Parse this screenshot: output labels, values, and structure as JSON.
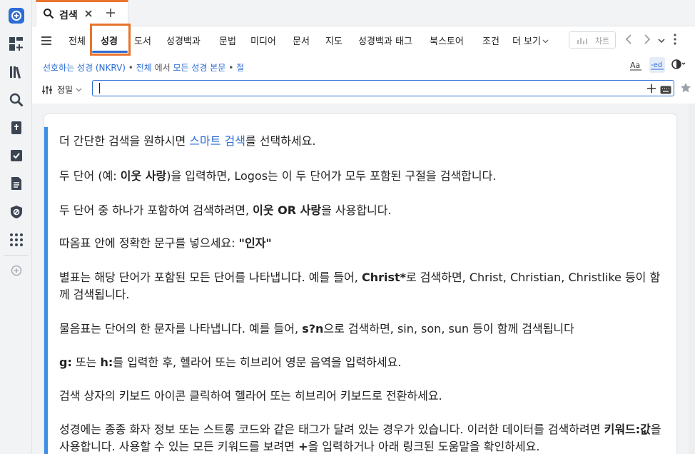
{
  "tab": {
    "label": "검색"
  },
  "categories": [
    "전체",
    "성경",
    "도서",
    "성경백과",
    "문법",
    "미디어",
    "문서",
    "지도",
    "성경백과 태그",
    "북스토어",
    "조건",
    "더 보기"
  ],
  "selected_category": "성경",
  "chart_button": {
    "label": "차트"
  },
  "scope": {
    "preferred_bible": "선호하는 성경 (NKRV)",
    "sep1": " • ",
    "all": "전체",
    "in_text": " 에서 ",
    "all_bible_text": "모든 성경 본문",
    "sep2": " • ",
    "verse": "절"
  },
  "options": {
    "precision": "정밀"
  },
  "search": {
    "value": "",
    "placeholder": ""
  },
  "help": [
    {
      "a": "더 간단한 검색을 원하시면 ",
      "link": "스마트 검색",
      "b": "를 선택하세요."
    },
    {
      "a": "두 단어 (예: ",
      "bold": "이웃 사랑",
      "b": ")을 입력하면, Logos는 이 두 단어가 모두 포함된 구절을 검색합니다."
    },
    {
      "a": "두 단어 중 하나가 포함하여 검색하려면, ",
      "bold": "이웃 OR 사랑",
      "b": "을 사용합니다."
    },
    {
      "a": "따옴표 안에 정확한 문구를 넣으세요: ",
      "bold": "\"인자\"",
      "b": ""
    },
    {
      "a": "별표는 해당 단어가 포함된 모든 단어를 나타냅니다. 예를 들어, ",
      "bold": "Christ*",
      "b": "로 검색하면, Christ, Christian, Christlike 등이 함께 검색됩니다."
    },
    {
      "a": "물음표는 단어의 한 문자를 나타냅니다. 예를 들어,  ",
      "bold": "s?n",
      "b": "으로 검색하면, sin, son, sun 등이 함께 검색됩니다"
    },
    {
      "bold1": "g:",
      "a": " 또는 ",
      "bold2": "h:",
      "b": "를 입력한 후, 헬라어 또는 히브리어 영문 음역을 입력하세요."
    },
    {
      "a": "검색 상자의 키보드 아이콘 클릭하여 헬라어 또는 히브리어 키보드로 전환하세요."
    },
    {
      "a": "성경에는 종종 화자 정보 또는 스트롱 코드와 같은 태그가 달려 있는 경우가 있습니다.  이러한 데이터를 검색하려면 ",
      "bold": "키워드:값",
      "b": "을 사용합니다. 사용할 수 있는 모든 키워드를 보려면 ",
      "bold2": "+",
      "c": "을 입력하거나 아래 링크된 도움말을 확인하세요."
    }
  ],
  "colors": {
    "accent_blue": "#2d6dd6",
    "highlight_orange": "#e8732c",
    "card_accent": "#3d8fe6"
  }
}
